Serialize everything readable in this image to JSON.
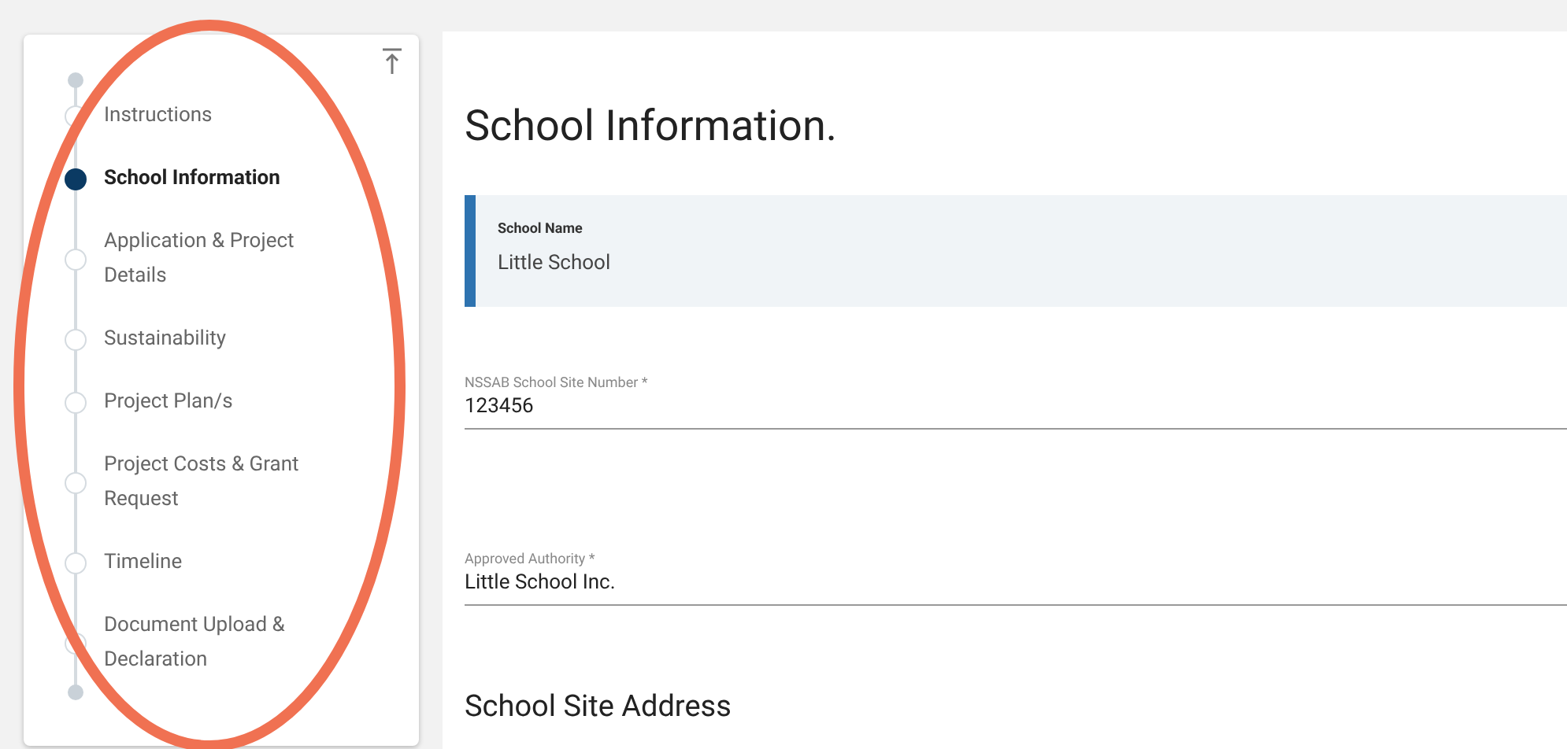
{
  "sidebar": {
    "items": [
      {
        "label": "Instructions",
        "selected": false
      },
      {
        "label": "School Information",
        "selected": true
      },
      {
        "label": "Application & Project Details",
        "selected": false
      },
      {
        "label": "Sustainability",
        "selected": false
      },
      {
        "label": "Project Plan/s",
        "selected": false
      },
      {
        "label": "Project Costs & Grant Request",
        "selected": false
      },
      {
        "label": "Timeline",
        "selected": false
      },
      {
        "label": "Document Upload & Declaration",
        "selected": false
      }
    ]
  },
  "main": {
    "title": "School Information.",
    "school_name": {
      "label": "School Name",
      "value": "Little School"
    },
    "fields": [
      {
        "label": "NSSAB School Site Number *",
        "value": "123456"
      },
      {
        "label": "Approved Authority *",
        "value": "Little School Inc."
      }
    ],
    "section_title": "School Site Address"
  }
}
